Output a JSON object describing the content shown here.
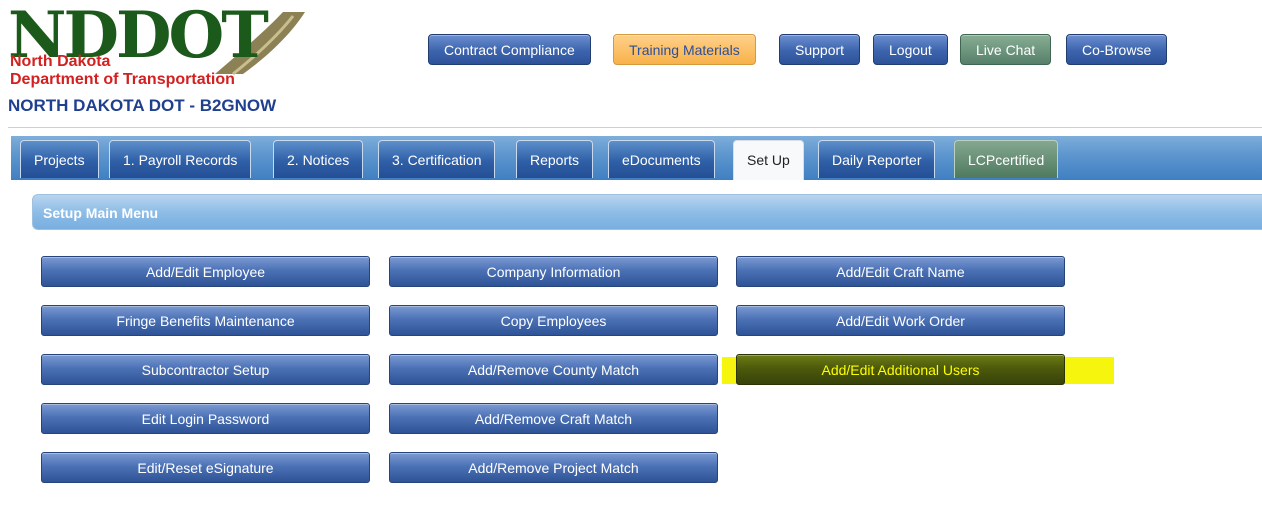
{
  "logo": {
    "text": "NDDOT",
    "line1": "North Dakota",
    "line2": "Department of Transportation"
  },
  "site_title": "NORTH DAKOTA DOT - B2GNOW",
  "top_buttons": {
    "contract_compliance": "Contract Compliance",
    "training_materials": "Training Materials",
    "support": "Support",
    "logout": "Logout",
    "live_chat": "Live Chat",
    "co_browse": "Co-Browse"
  },
  "tabs": [
    {
      "label": "Projects"
    },
    {
      "label": "1. Payroll Records"
    },
    {
      "label": "2. Notices"
    },
    {
      "label": "3. Certification"
    },
    {
      "label": "Reports"
    },
    {
      "label": "eDocuments"
    },
    {
      "label": "Set Up",
      "active": true
    },
    {
      "label": "Daily Reporter"
    },
    {
      "label": "LCPcertified"
    }
  ],
  "section": {
    "title": "Setup Main Menu"
  },
  "menu": {
    "col1": [
      "Add/Edit Employee",
      "Fringe Benefits Maintenance",
      "Subcontractor Setup",
      "Edit Login Password",
      "Edit/Reset eSignature"
    ],
    "col2": [
      "Company Information",
      "Copy Employees",
      "Add/Remove County Match",
      "Add/Remove Craft Match",
      "Add/Remove Project Match"
    ],
    "col3": [
      "Add/Edit Craft Name",
      "Add/Edit Work Order",
      "Add/Edit Additional Users"
    ]
  },
  "colors": {
    "nav_blue": "#3c64ad",
    "training_orange": "#f8b24a",
    "live_chat_green": "#56806a",
    "highlight_yellow": "#f5f50e",
    "logo_green": "#1c5a1c",
    "logo_red": "#d32020"
  }
}
